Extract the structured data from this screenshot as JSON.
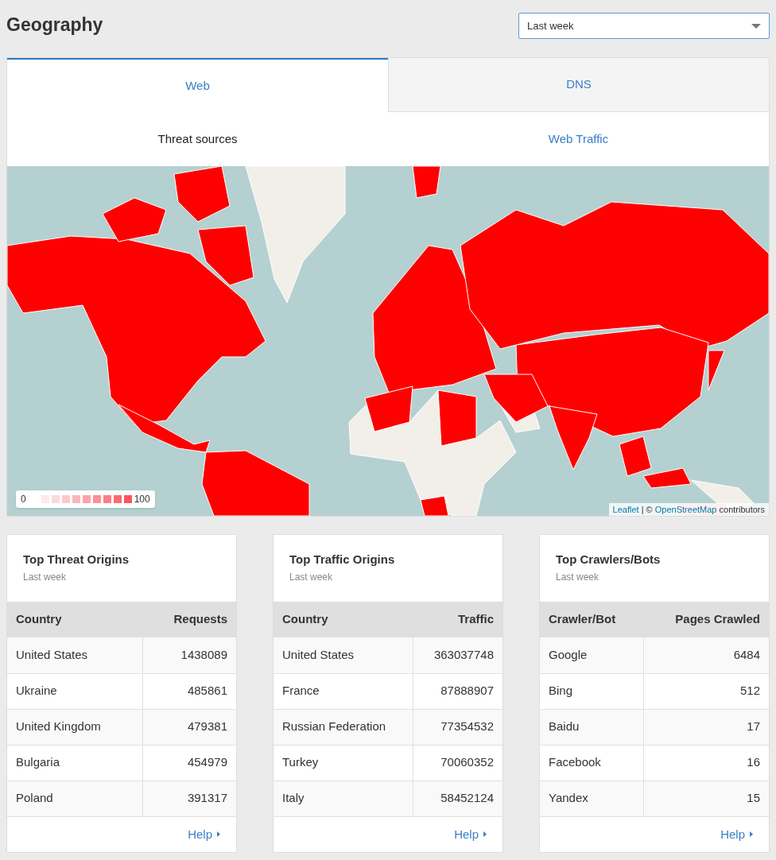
{
  "page": {
    "title": "Geography"
  },
  "period_select": {
    "value": "Last week"
  },
  "tabs": [
    {
      "label": "Web",
      "selected": true
    },
    {
      "label": "DNS",
      "selected": false
    }
  ],
  "subtabs": [
    {
      "label": "Threat sources",
      "selected": true
    },
    {
      "label": "Web Traffic",
      "selected": false
    }
  ],
  "map": {
    "legend": {
      "min_label": "0",
      "max_label": "100",
      "swatches": [
        {
          "color": "#fde9eb"
        },
        {
          "color": "#fdd9dc"
        },
        {
          "color": "#fdc8cc"
        },
        {
          "color": "#fdb5b9"
        },
        {
          "color": "#fca3a7"
        },
        {
          "color": "#fb9196"
        },
        {
          "color": "#fa7f85"
        },
        {
          "color": "#f96a72"
        },
        {
          "color": "#f8565f"
        }
      ]
    },
    "attribution": [
      {
        "kind": "link",
        "text": "Leaflet"
      },
      {
        "kind": "text",
        "text": "| ©"
      },
      {
        "kind": "link",
        "text": "OpenStreetMap"
      },
      {
        "kind": "text",
        "text": "contributors"
      }
    ]
  },
  "cards": [
    {
      "title": "Top Threat Origins",
      "subtitle": "Last week",
      "columns": [
        "Country",
        "Requests"
      ],
      "rows": [
        [
          "United States",
          "1438089"
        ],
        [
          "Ukraine",
          "485861"
        ],
        [
          "United Kingdom",
          "479381"
        ],
        [
          "Bulgaria",
          "454979"
        ],
        [
          "Poland",
          "391317"
        ]
      ],
      "help_link": "Help"
    },
    {
      "title": "Top Traffic Origins",
      "subtitle": "Last week",
      "columns": [
        "Country",
        "Traffic"
      ],
      "rows": [
        [
          "United States",
          "363037748"
        ],
        [
          "France",
          "87888907"
        ],
        [
          "Russian Federation",
          "77354532"
        ],
        [
          "Turkey",
          "70060352"
        ],
        [
          "Italy",
          "58452124"
        ]
      ],
      "help_link": "Help"
    },
    {
      "title": "Top Crawlers/Bots",
      "subtitle": "Last week",
      "columns": [
        "Crawler/Bot",
        "Pages Crawled"
      ],
      "rows": [
        [
          "Google",
          "6484"
        ],
        [
          "Bing",
          "512"
        ],
        [
          "Baidu",
          "17"
        ],
        [
          "Facebook",
          "16"
        ],
        [
          "Yandex",
          "15"
        ]
      ],
      "help_link": "Help"
    }
  ]
}
